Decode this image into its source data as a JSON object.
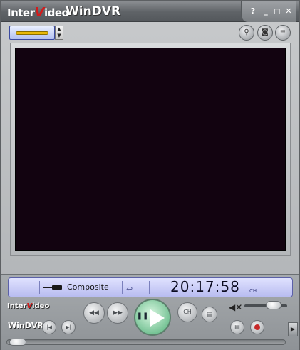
{
  "window": {
    "brand_inter": "Inter",
    "brand_v": "V",
    "brand_ideo": "ideo",
    "title": "WinDVR",
    "controls": {
      "help": "?",
      "minimize": "_",
      "restore": "◻",
      "close": "✕"
    }
  },
  "toolbar": {
    "source_icon": "composite-cable-icon",
    "spin_up": "▲",
    "spin_down": "▼",
    "zoom_icon": "magnifier-icon",
    "snapshot_icon": "camera-icon",
    "list_icon": "list-icon",
    "zoom_glyph": "⚲",
    "snapshot_glyph": "◙",
    "list_glyph": "≡"
  },
  "status": {
    "source": "Composite",
    "time": "20:17:58",
    "ch": "CH",
    "return_glyph": "↩"
  },
  "panel": {
    "brand_inter": "Inter",
    "brand_v": "V",
    "brand_ideo": "ideo",
    "app_label": "WinDVR",
    "rewind_glyph": "◀◀",
    "forward_glyph": "▶▶",
    "prev_glyph": "|◀",
    "next_glyph": "▶|",
    "pause_glyph": "❚❚",
    "ch_glyph": "CH",
    "mute_glyph": "◀✕",
    "tool_glyph": "▤",
    "side_glyph": "▶"
  },
  "colors": {
    "lcd": "#c9ccf5",
    "video": "#120310",
    "play": "#4fae77",
    "record": "#c62828",
    "brand_red": "#d41b1b"
  }
}
